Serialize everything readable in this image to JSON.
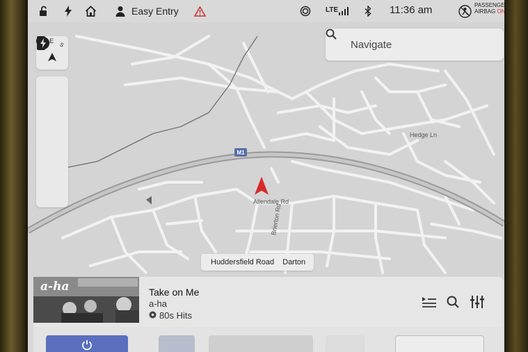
{
  "status_bar": {
    "profile_name": "Easy Entry",
    "network": "LTE",
    "time": "11:36 am",
    "airbag_line1": "PASSENGER",
    "airbag_line2": "AIRBAG",
    "airbag_state": "ON"
  },
  "compass": {
    "east": "E",
    "north_left": "E",
    "south": "S"
  },
  "search": {
    "placeholder": "Navigate"
  },
  "map": {
    "motorway": "M1",
    "roads": {
      "hedge": "Hedge Ln",
      "allendale": "Allendale Rd",
      "brierton": "Brierton Rd"
    },
    "location": {
      "road": "Huddersfield Road",
      "area": "Darton"
    }
  },
  "media": {
    "title": "Take on Me",
    "artist": "a-ha",
    "source": "80s Hits",
    "album_text": "a-ha"
  },
  "colors": {
    "accent": "#5a6fbd",
    "alert": "#d03030",
    "car_marker": "#d82a2a",
    "motorway": "#5a6ea8"
  }
}
